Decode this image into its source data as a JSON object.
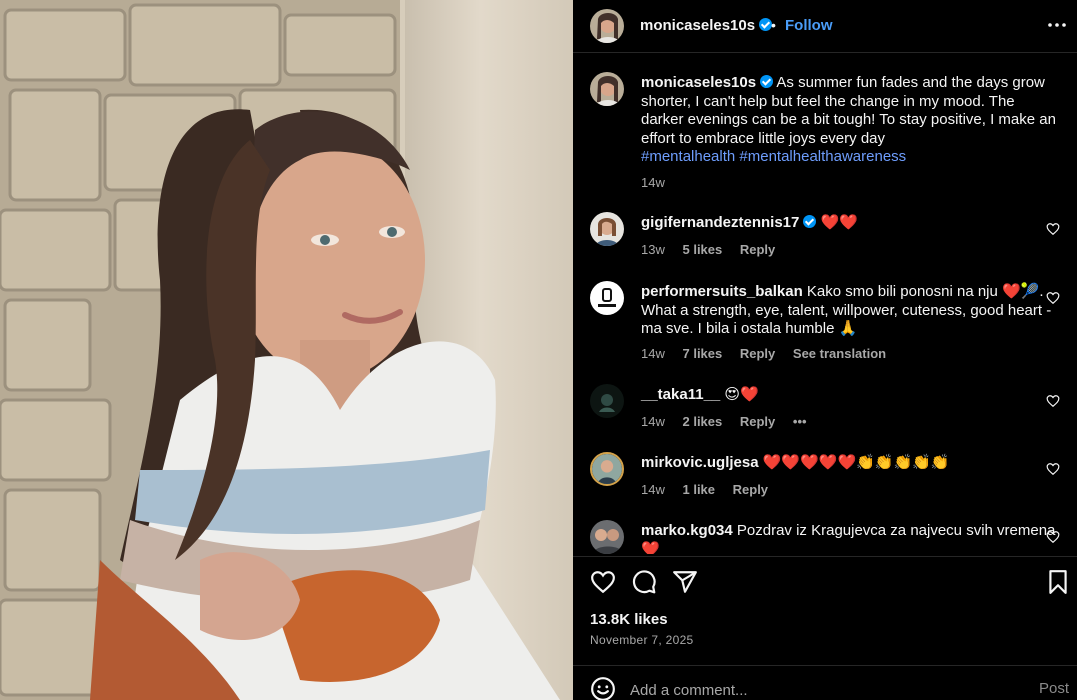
{
  "post": {
    "author": "monicaseles10s",
    "follow_label": "Follow",
    "dot": "•",
    "caption_text": "As summer fun fades and the days grow shorter, I can't help but feel the change in my mood. The darker evenings can be a bit tough! To stay positive, I make an effort to embrace little joys every day",
    "caption_tags": "#mentalhealth #mentalhealthawareness",
    "caption_time": "14w",
    "likes": "13.8K likes",
    "date": "November 7, 2025"
  },
  "comments": [
    {
      "user": "gigifernandeztennis17",
      "verified": true,
      "text": "❤️❤️",
      "time": "13w",
      "likes": "5 likes",
      "reply": "Reply",
      "extra": ""
    },
    {
      "user": "performersuits_balkan",
      "verified": false,
      "text": "Kako smo bili ponosni na nju ❤️🎾. What a strength, eye, talent, willpower, cuteness, good heart - ma sve. I bila i ostala humble 🙏",
      "time": "14w",
      "likes": "7 likes",
      "reply": "Reply",
      "extra": "See translation"
    },
    {
      "user": "__taka11__",
      "verified": false,
      "text": "😍❤️",
      "time": "14w",
      "likes": "2 likes",
      "reply": "Reply",
      "extra": "•••"
    },
    {
      "user": "mirkovic.ugljesa",
      "verified": false,
      "text": "❤️❤️❤️❤️❤️👏👏👏👏👏",
      "time": "14w",
      "likes": "1 like",
      "reply": "Reply",
      "extra": ""
    },
    {
      "user": "marko.kg034",
      "verified": false,
      "text": "Pozdrav iz Kragujevca za najvecu svih vremena❤️",
      "time": "",
      "likes": "",
      "reply": "",
      "extra": ""
    }
  ],
  "add_comment": {
    "placeholder": "Add a comment...",
    "post_label": "Post"
  },
  "icons": {
    "header_avatar": "profile-avatar",
    "more": "more-options-icon",
    "verified": "verified-badge-icon",
    "like": "heart-icon",
    "comment": "comment-icon",
    "share": "share-icon",
    "save": "bookmark-icon",
    "emoji": "emoji-icon"
  },
  "colors": {
    "link": "#6e9dfc",
    "follow": "#4a9df8",
    "verified": "#0095f6",
    "muted": "#a8a8a8"
  }
}
